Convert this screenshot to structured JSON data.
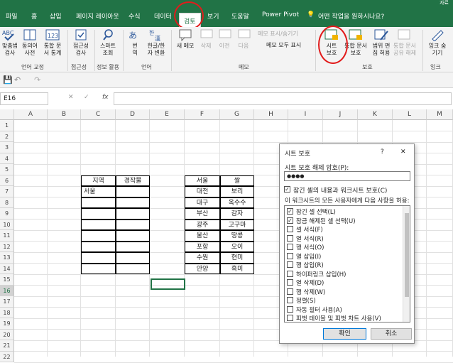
{
  "window": {
    "title_fragment": "자료"
  },
  "tabs": [
    "파일",
    "홈",
    "삽입",
    "페이지 레이아웃",
    "수식",
    "데이터",
    "검토",
    "보기",
    "도움말",
    "Power Pivot"
  ],
  "tell_me": "어떤 작업을 원하시나요?",
  "ribbon": {
    "spelling": "맞춤법\n검사",
    "thesaurus": "동의어\n사전",
    "stats": "통합 문\n서 통계",
    "lang_check": "접근성\n검사",
    "smart": "스마트\n조회",
    "translate": "번\n역",
    "hanja": "한글/한\n자 변환",
    "new_memo": "새 메모",
    "delete": "삭제",
    "prev": "이전",
    "next": "다음",
    "show_hide": "메모 표시/숨기기",
    "show_all": "메모 모두 표시",
    "protect_sheet": "시트\n보호",
    "protect_wb": "통합 문서\n보호",
    "allow_edit": "범위 편\n집 허용",
    "unshare": "통합 문서\n공유 해제",
    "ink": "잉크 숨\n기기",
    "groups": [
      "언어 교정",
      "접근성",
      "정보 활용",
      "언어",
      "메모",
      "보호",
      "잉크"
    ]
  },
  "formula_bar": {
    "name_box": "E16",
    "fx": "fx"
  },
  "columns": [
    "A",
    "B",
    "C",
    "D",
    "E",
    "F",
    "G",
    "H",
    "I",
    "J",
    "K",
    "L",
    "M"
  ],
  "rows": [
    "1",
    "2",
    "3",
    "4",
    "5",
    "6",
    "7",
    "8",
    "9",
    "10",
    "11",
    "12",
    "13",
    "14",
    "15",
    "16",
    "17",
    "18",
    "19",
    "20",
    "21",
    "22"
  ],
  "table1": {
    "h1": "지역",
    "h2": "경작물",
    "r1": "서울"
  },
  "table2": [
    [
      "서울",
      "쌀"
    ],
    [
      "대전",
      "보리"
    ],
    [
      "대구",
      "옥수수"
    ],
    [
      "부산",
      "감자"
    ],
    [
      "광주",
      "고구마"
    ],
    [
      "울산",
      "땅콩"
    ],
    [
      "포항",
      "오이"
    ],
    [
      "수원",
      "현미"
    ],
    [
      "안양",
      "흑미"
    ]
  ],
  "dialog": {
    "title": "시트 보호",
    "help": "?",
    "close": "✕",
    "pw_label": "시트 보호 해제 암호(P):",
    "pw_value": "●●●●",
    "protect_cb": "잠긴 셀의 내용과 워크시트 보호(C)",
    "allow_label": "이 워크시트의 모든 사용자에게 다음 사항을 허용:",
    "options": [
      {
        "label": "잠긴 셀 선택(L)",
        "checked": true
      },
      {
        "label": "잠금 해제된 셀 선택(U)",
        "checked": true
      },
      {
        "label": "셀 서식(F)",
        "checked": false
      },
      {
        "label": "열 서식(R)",
        "checked": false
      },
      {
        "label": "행 서식(O)",
        "checked": false
      },
      {
        "label": "열 삽입(I)",
        "checked": false
      },
      {
        "label": "행 삽입(R)",
        "checked": false
      },
      {
        "label": "하이퍼링크 삽입(H)",
        "checked": false
      },
      {
        "label": "열 삭제(D)",
        "checked": false
      },
      {
        "label": "행 삭제(W)",
        "checked": false
      },
      {
        "label": "정렬(S)",
        "checked": false
      },
      {
        "label": "자동 필터 사용(A)",
        "checked": false
      },
      {
        "label": "피벗 테이블 및 피벗 차트 사용(V)",
        "checked": false
      }
    ],
    "ok": "확인",
    "cancel": "취소"
  }
}
